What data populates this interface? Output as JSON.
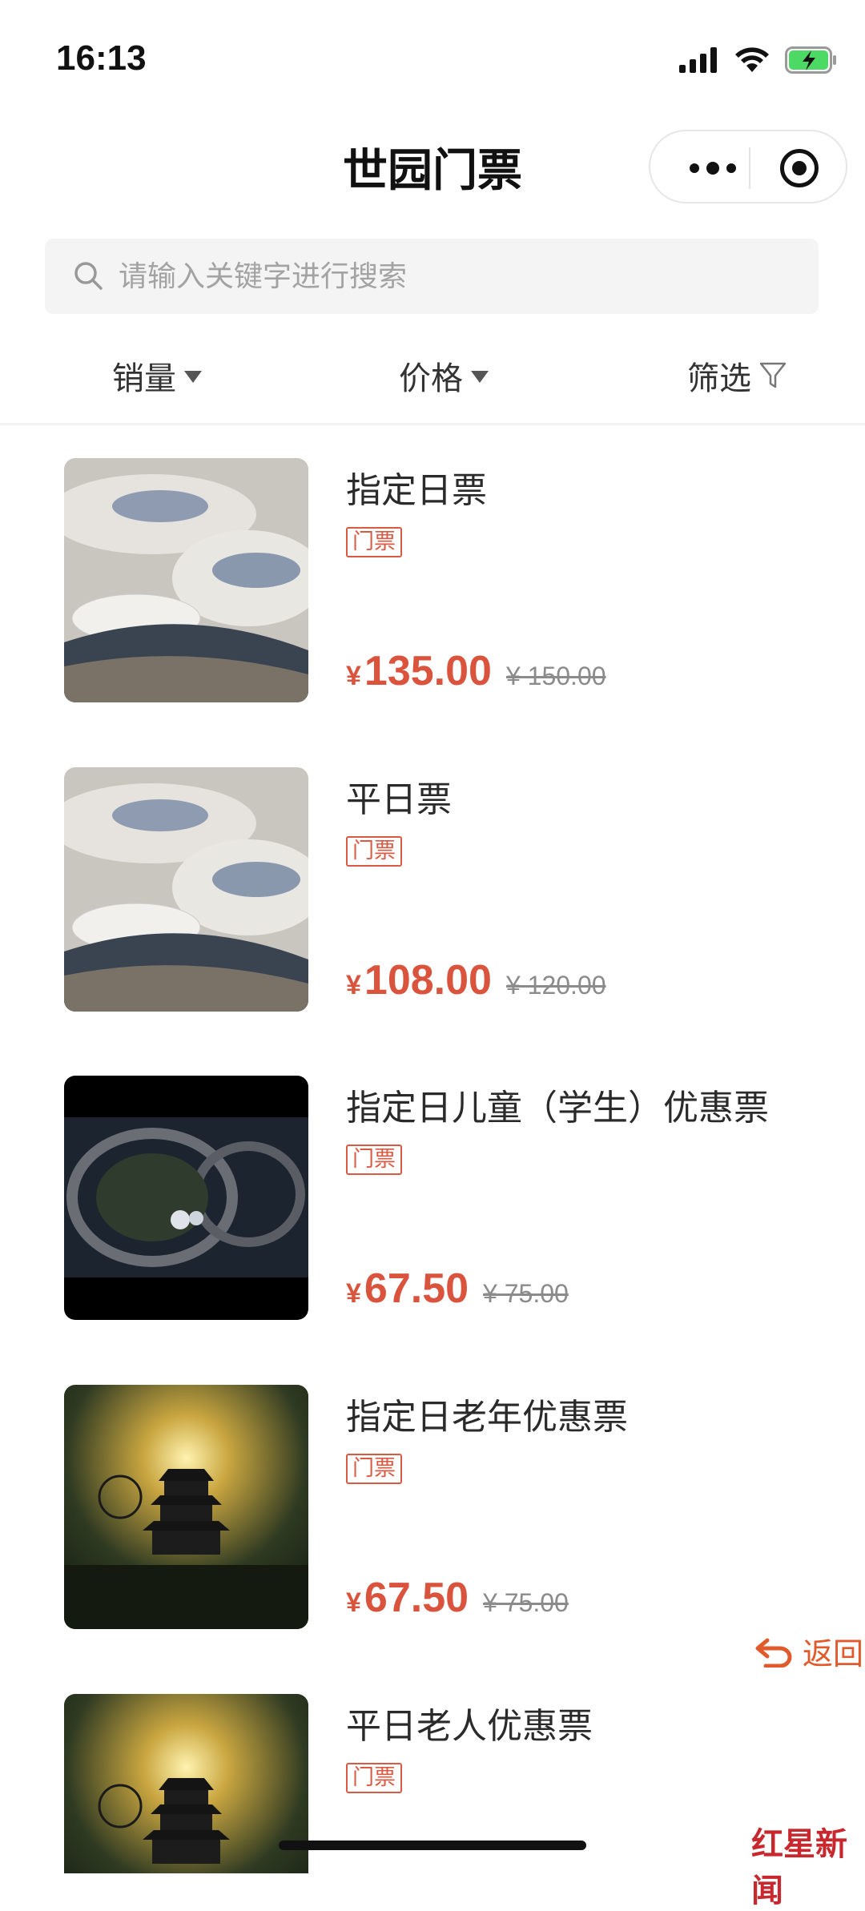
{
  "status": {
    "time": "16:13"
  },
  "nav": {
    "title": "世园门票"
  },
  "search": {
    "placeholder": "请输入关键字进行搜索"
  },
  "sort": {
    "sales": "销量",
    "price": "价格",
    "filter": "筛选"
  },
  "products": [
    {
      "title": "指定日票",
      "tag": "门票",
      "yen": "¥",
      "price": "135.00",
      "original": "¥ 150.00",
      "image": "expo-aerial-day"
    },
    {
      "title": "平日票",
      "tag": "门票",
      "yen": "¥",
      "price": "108.00",
      "original": "¥ 120.00",
      "image": "expo-aerial-day"
    },
    {
      "title": "指定日儿童（学生）优惠票",
      "tag": "门票",
      "yen": "¥",
      "price": "67.50",
      "original": "¥ 75.00",
      "image": "expo-aerial-night"
    },
    {
      "title": "指定日老年优惠票",
      "tag": "门票",
      "yen": "¥",
      "price": "67.50",
      "original": "¥ 75.00",
      "image": "pagoda-sunrise"
    },
    {
      "title": "平日老人优惠票",
      "tag": "门票",
      "image": "pagoda-sunrise"
    }
  ],
  "back": {
    "label": "返回"
  },
  "watermark": {
    "text": "红星新闻"
  },
  "colors": {
    "price": "#d9533d",
    "tag": "#d95a43",
    "back": "#e05a2c"
  }
}
